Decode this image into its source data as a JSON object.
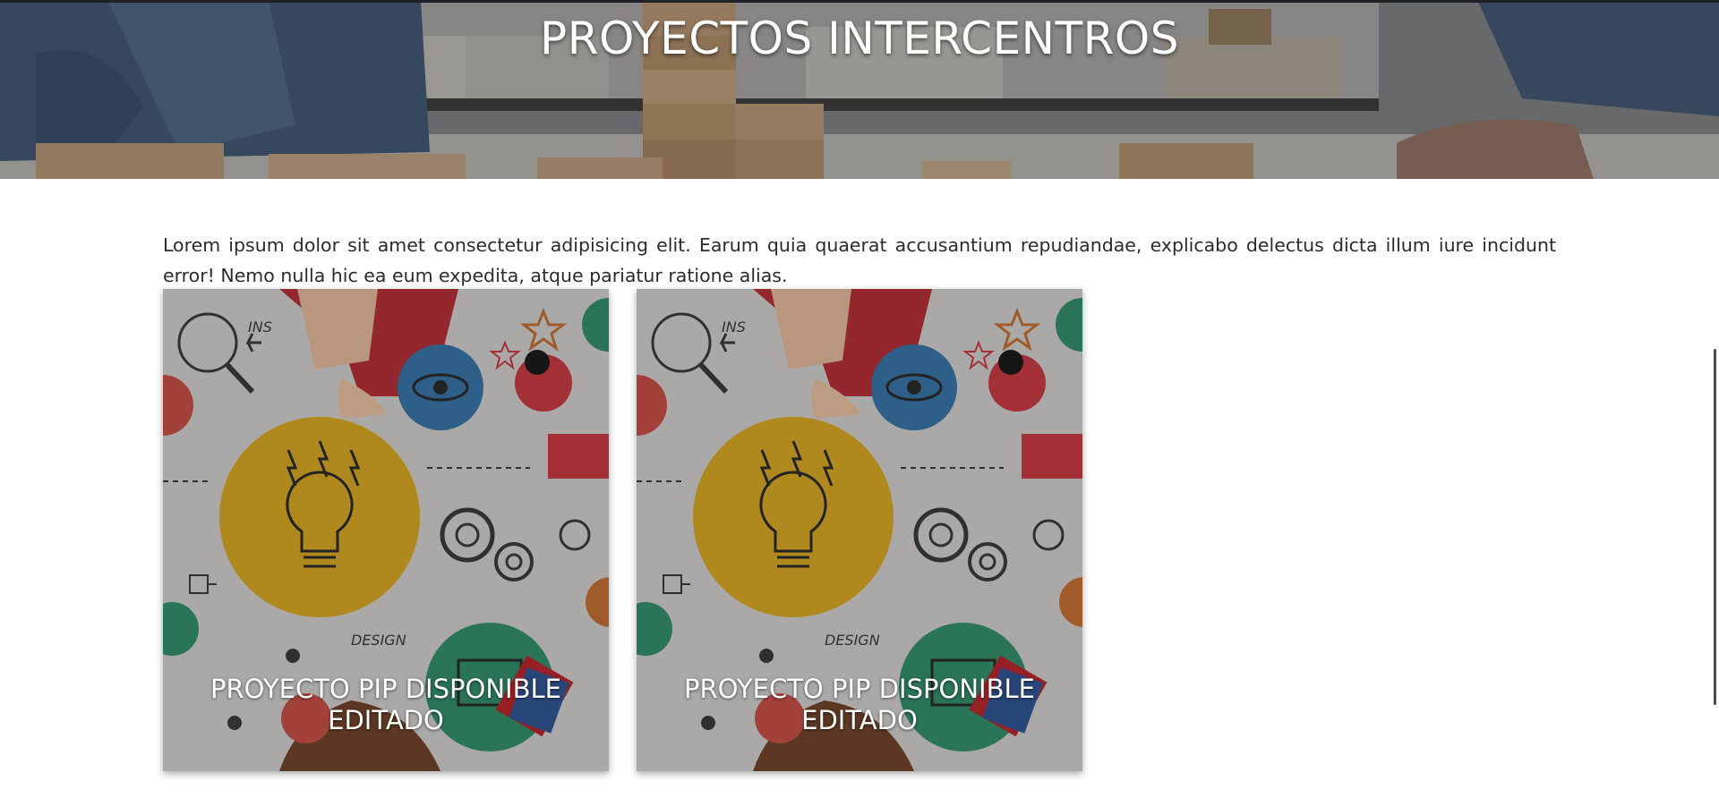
{
  "hero": {
    "title": "PROYECTOS INTERCENTROS"
  },
  "intro": {
    "text": "Lorem ipsum dolor sit amet consectetur adipisicing elit. Earum quia quaerat accusantium repudiandae, explicabo delectus dicta illum iure incidunt error! Nemo nulla hic ea eum expedita, atque pariatur ratione alias."
  },
  "cards": [
    {
      "title_line1": "PROYECTO PIP DISPONIBLE",
      "title_line2": "EDITADO",
      "image_text_ins": "INS",
      "image_text_design": "DESIGN"
    },
    {
      "title_line1": "PROYECTO PIP DISPONIBLE",
      "title_line2": "EDITADO",
      "image_text_ins": "INS",
      "image_text_design": "DESIGN"
    }
  ],
  "colors": {
    "accent_yellow": "#d5a51a",
    "accent_blue": "#2f6fa3",
    "accent_red": "#c6323c",
    "accent_green": "#2b8a64"
  }
}
